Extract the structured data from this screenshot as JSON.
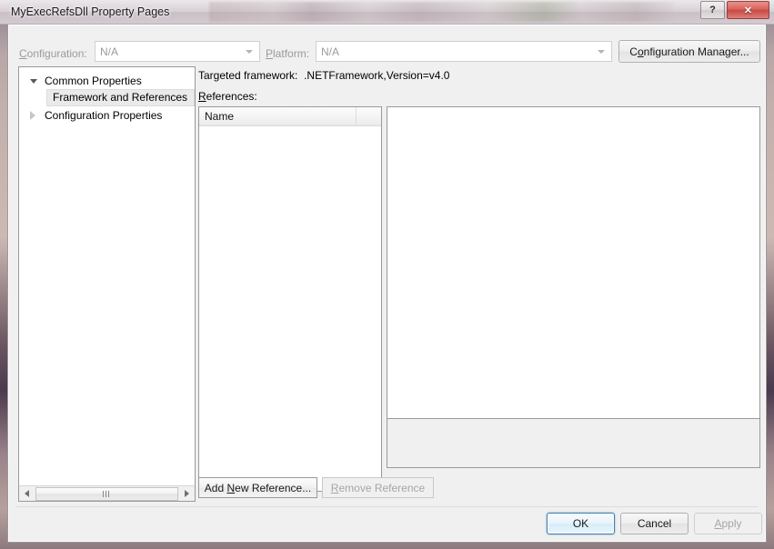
{
  "window": {
    "title": "MyExecRefsDll Property Pages",
    "help_button": "?",
    "close_button": "✕"
  },
  "toolbar": {
    "configuration_label": "Configuration:",
    "configuration_accel": "C",
    "configuration_value": "N/A",
    "platform_label": "Platform:",
    "platform_accel": "P",
    "platform_value": "N/A",
    "configuration_manager_label": "Configuration Manager...",
    "configuration_manager_pre": "C",
    "configuration_manager_accel": "o",
    "configuration_manager_post": "nfiguration Manager..."
  },
  "tree": {
    "items": [
      {
        "label": "Common Properties",
        "state": "expanded",
        "selected": false
      },
      {
        "label": "Framework and References",
        "state": "leaf",
        "selected": true
      },
      {
        "label": "Configuration Properties",
        "state": "collapsed",
        "selected": false
      }
    ],
    "scrollbar": {
      "left_arrow": "◀",
      "right_arrow": "▶"
    }
  },
  "main": {
    "targeted_framework_label": "Targeted framework:",
    "targeted_framework_value": ".NETFramework,Version=v4.0",
    "references_label": "References:",
    "references_accel": "R",
    "columns": [
      {
        "label": "Name",
        "width": 175
      },
      {
        "label": "",
        "width": 27
      }
    ],
    "rows": [],
    "add_reference_pre": "Add ",
    "add_reference_accel": "N",
    "add_reference_post": "ew Reference...",
    "remove_reference_accel": "R",
    "remove_reference_post": "emove Reference",
    "remove_reference_enabled": false
  },
  "footer": {
    "ok_label": "OK",
    "cancel_label": "Cancel",
    "apply_label": "Apply",
    "apply_accel": "A",
    "apply_post": "pply",
    "apply_enabled": false
  },
  "colors": {
    "dialog_bg": "#f0f0f0",
    "default_button_border": "#3c7fb1",
    "close_button": "#c64a45",
    "disabled_text": "#a6a6a6"
  }
}
